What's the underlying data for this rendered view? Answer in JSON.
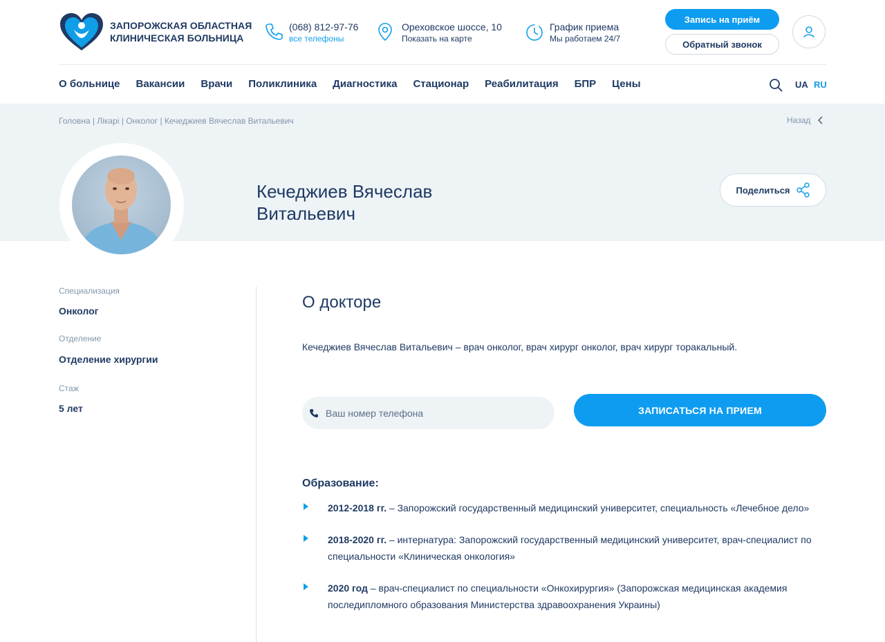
{
  "header": {
    "logo_line1": "ЗАПОРОЖСКАЯ ОБЛАСТНАЯ",
    "logo_line2": "КЛИНИЧЕСКАЯ БОЛЬНИЦА",
    "phone": "(068) 812-97-76",
    "phone_sub": "все телефоны",
    "address": "Ореховское шоссе, 10",
    "address_sub": "Показать на карте",
    "schedule": "График приема",
    "schedule_sub": "Мы работаем 24/7",
    "record_label": "Запись на приём",
    "callback_label": "Обратный звонок",
    "lang_ua": "UA",
    "lang_ru": "RU",
    "colors": {
      "accent": "#0d9cf0",
      "text": "#1f3a63",
      "band": "#eef3f6"
    }
  },
  "nav": {
    "items": [
      {
        "label": "О больнице"
      },
      {
        "label": "Вакансии"
      },
      {
        "label": "Врачи"
      },
      {
        "label": "Поликлиника"
      },
      {
        "label": "Диагностика"
      },
      {
        "label": "Стационар"
      },
      {
        "label": "Реабилитация"
      },
      {
        "label": "БПР"
      },
      {
        "label": "Цены"
      }
    ]
  },
  "breadcrumbs": {
    "text": "Головна | Лікарі | Онколог | Кечеджиев Вячеслав Витальевич",
    "back": "Назад"
  },
  "doctor": {
    "name_line1": "Кечеджиев Вячеслав",
    "name_line2": "Витальевич",
    "share_label": "Поделиться"
  },
  "sidebar": {
    "spec_label": "Специализация",
    "spec_value": "Онколог",
    "dept_label": "Отделение",
    "dept_value": "Отделение хирургии",
    "exp_label": "Стаж",
    "exp_value": "5 лет"
  },
  "about": {
    "title": "О докторе",
    "text": "Кечеджиев Вячеслав Витальевич – врач онколог, врач хирург онколог, врач хирург торакальный."
  },
  "form": {
    "phone_placeholder": "Ваш номер телефона",
    "submit_label": "ЗАПИСАТЬСЯ НА ПРИЕМ"
  },
  "education": {
    "title": "Образование:",
    "items": [
      {
        "years": "2012-2018 гг.",
        "text": " – Запорожский государственный медицинский университет, специальность «Лечебное дело»"
      },
      {
        "years": "2018-2020 гг.",
        "text": " – интернатура: Запорожский государственный медицинский университет, врач-специалист по специальности «Клиническая онкология»"
      },
      {
        "years": "2020 год",
        "text": " – врач-специалист по специальности «Онкохирургия» (Запорожская медицинская академия последипломного образования Министерства здравоохранения Украины)"
      }
    ]
  }
}
